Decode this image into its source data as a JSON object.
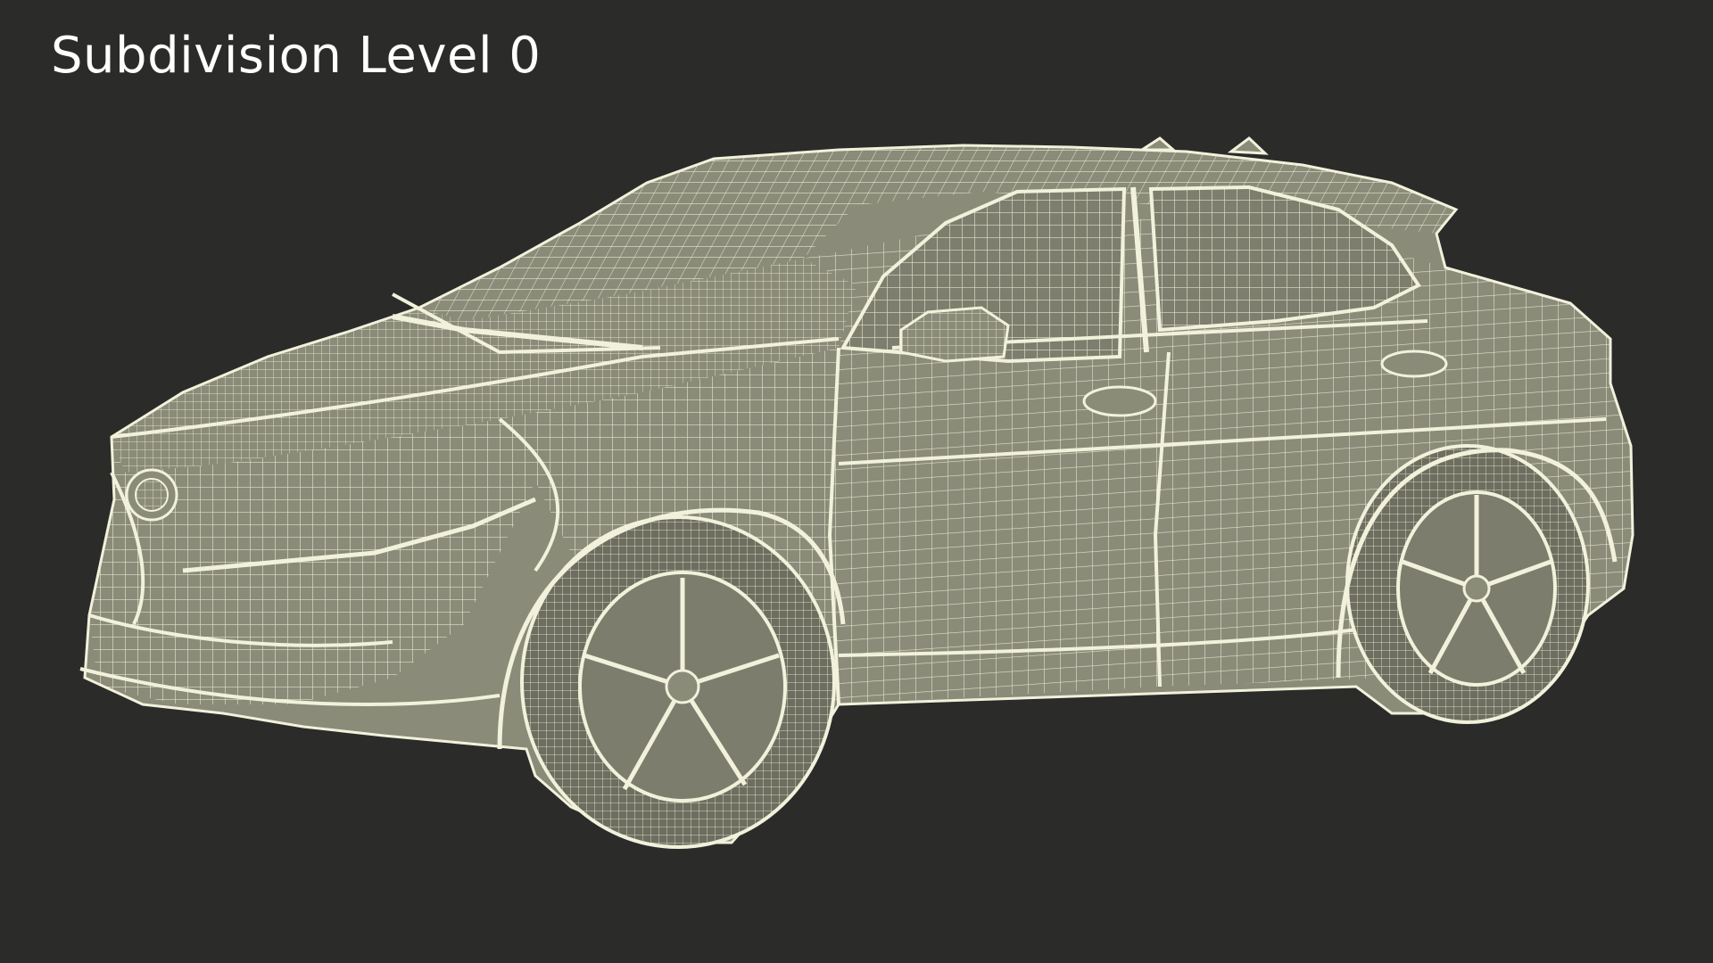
{
  "caption": "Subdivision Level 0",
  "colors": {
    "background": "#2b2b2a",
    "mesh_fill": "#8a8b78",
    "mesh_shadow": "#6d6e5f",
    "wire": "#f1f1dc",
    "caption_text": "#ffffff"
  },
  "subject": {
    "icon": "car-wireframe-icon"
  }
}
